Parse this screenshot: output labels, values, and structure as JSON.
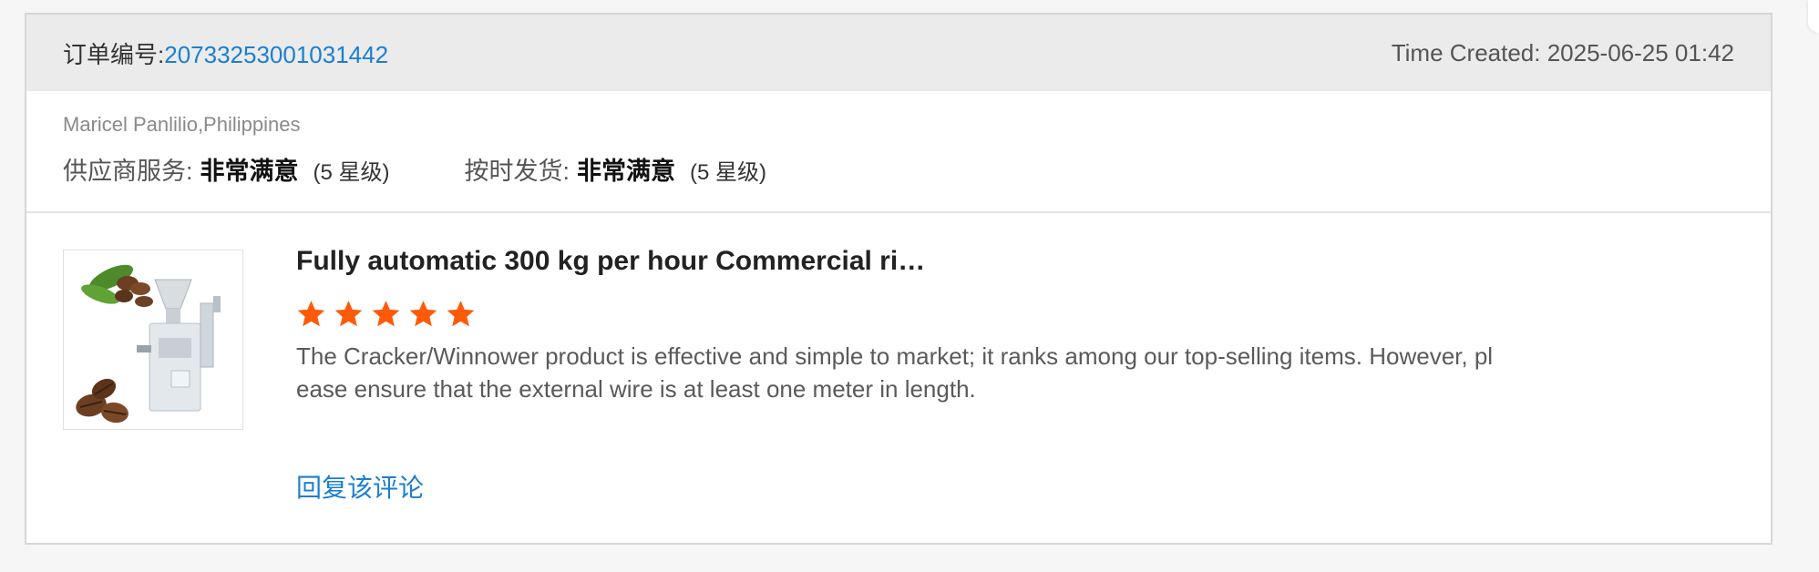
{
  "header": {
    "order_label": "订单编号:",
    "order_number": "20733253001031442",
    "time_created": "Time Created: 2025-06-25 01:42"
  },
  "buyer": {
    "name_country": "Maricel Panlilio,Philippines"
  },
  "ratings": [
    {
      "label": "供应商服务:",
      "value": "非常满意",
      "stars_text": "(5 星级)"
    },
    {
      "label": "按时发货:",
      "value": "非常满意",
      "stars_text": "(5 星级)"
    }
  ],
  "review": {
    "product_title": "Fully automatic 300 kg per hour Commercial ri…",
    "product_image_icon": "rice-huller-machine-with-coffee-beans",
    "rating_stars": 5,
    "star_color": "#ff5a0a",
    "comment": "The Cracker/Winnower product is effective and simple to market; it ranks among our top-selling items. However, please ensure that the external wire is at least one meter in length.",
    "reply_label": "回复该评论"
  }
}
